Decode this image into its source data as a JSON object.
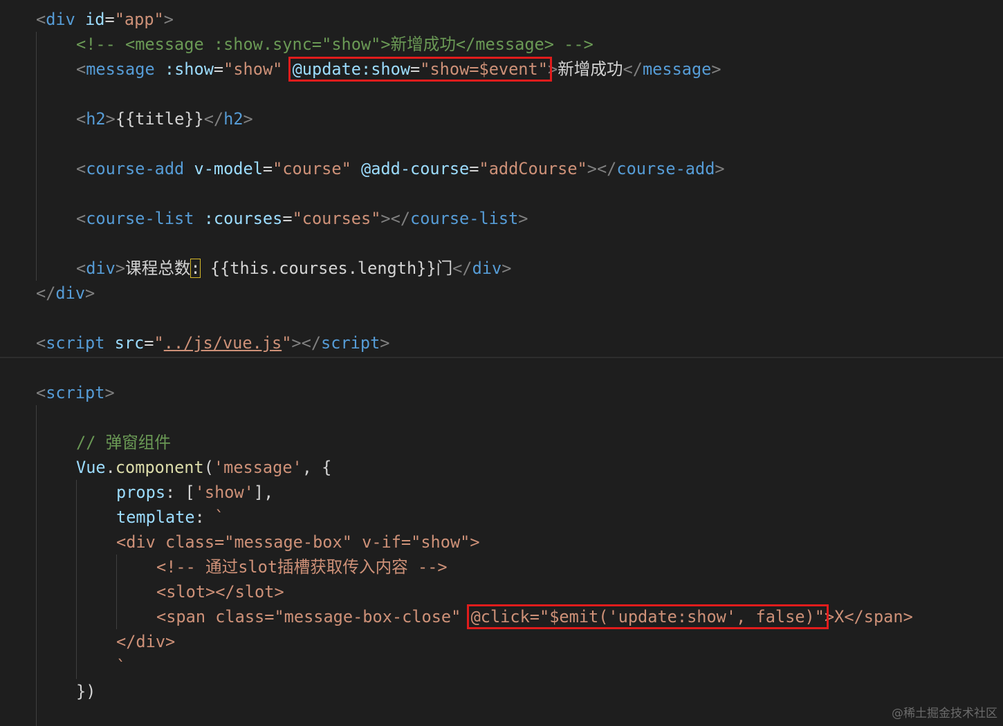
{
  "editor": {
    "colors": {
      "background": "#1e1e1e",
      "tag": "#569cd6",
      "attribute": "#9cdcfe",
      "string": "#ce9178",
      "comment": "#6a9955",
      "function": "#dcdcaa",
      "highlight_box": "#e11c1c"
    },
    "lines": [
      {
        "tokens": [
          {
            "t": "<",
            "c": "ang"
          },
          {
            "t": "div",
            "c": "tag"
          },
          {
            "t": " ",
            "c": "text"
          },
          {
            "t": "id",
            "c": "attr"
          },
          {
            "t": "=",
            "c": "eq"
          },
          {
            "t": "\"app\"",
            "c": "str"
          },
          {
            "t": ">",
            "c": "ang"
          }
        ]
      },
      {
        "tokens": [
          {
            "t": "<!-- <message :show.sync=\"show\">新增成功</message> -->",
            "c": "com"
          }
        ]
      },
      {
        "tokens": [
          {
            "t": "<",
            "c": "ang"
          },
          {
            "t": "message",
            "c": "tag"
          },
          {
            "t": " ",
            "c": "text"
          },
          {
            "t": ":show",
            "c": "attr"
          },
          {
            "t": "=",
            "c": "eq"
          },
          {
            "t": "\"show\"",
            "c": "str"
          },
          {
            "t": " ",
            "c": "text"
          },
          {
            "t": "@update:show",
            "c": "attr"
          },
          {
            "t": "=",
            "c": "eq"
          },
          {
            "t": "\"show=$event\"",
            "c": "str"
          },
          {
            "t": ">",
            "c": "ang"
          },
          {
            "t": "新增成功",
            "c": "text"
          },
          {
            "t": "</",
            "c": "ang"
          },
          {
            "t": "message",
            "c": "tag"
          },
          {
            "t": ">",
            "c": "ang"
          }
        ]
      },
      {
        "tokens": []
      },
      {
        "tokens": [
          {
            "t": "<",
            "c": "ang"
          },
          {
            "t": "h2",
            "c": "tag"
          },
          {
            "t": ">",
            "c": "ang"
          },
          {
            "t": "{{title}}",
            "c": "text"
          },
          {
            "t": "</",
            "c": "ang"
          },
          {
            "t": "h2",
            "c": "tag"
          },
          {
            "t": ">",
            "c": "ang"
          }
        ]
      },
      {
        "tokens": []
      },
      {
        "tokens": [
          {
            "t": "<",
            "c": "ang"
          },
          {
            "t": "course-add",
            "c": "tag"
          },
          {
            "t": " ",
            "c": "text"
          },
          {
            "t": "v-model",
            "c": "attr"
          },
          {
            "t": "=",
            "c": "eq"
          },
          {
            "t": "\"course\"",
            "c": "str"
          },
          {
            "t": " ",
            "c": "text"
          },
          {
            "t": "@add-course",
            "c": "attr"
          },
          {
            "t": "=",
            "c": "eq"
          },
          {
            "t": "\"addCourse\"",
            "c": "str"
          },
          {
            "t": "></",
            "c": "ang"
          },
          {
            "t": "course-add",
            "c": "tag"
          },
          {
            "t": ">",
            "c": "ang"
          }
        ]
      },
      {
        "tokens": []
      },
      {
        "tokens": [
          {
            "t": "<",
            "c": "ang"
          },
          {
            "t": "course-list",
            "c": "tag"
          },
          {
            "t": " ",
            "c": "text"
          },
          {
            "t": ":courses",
            "c": "attr"
          },
          {
            "t": "=",
            "c": "eq"
          },
          {
            "t": "\"courses\"",
            "c": "str"
          },
          {
            "t": "></",
            "c": "ang"
          },
          {
            "t": "course-list",
            "c": "tag"
          },
          {
            "t": ">",
            "c": "ang"
          }
        ]
      },
      {
        "tokens": []
      },
      {
        "tokens": [
          {
            "t": "<",
            "c": "ang"
          },
          {
            "t": "div",
            "c": "tag"
          },
          {
            "t": ">",
            "c": "ang"
          },
          {
            "t": "课程总数",
            "c": "text"
          },
          {
            "t": ":",
            "c": "text"
          },
          {
            "t": " {{this.courses.length}}门",
            "c": "text"
          },
          {
            "t": "</",
            "c": "ang"
          },
          {
            "t": "div",
            "c": "tag"
          },
          {
            "t": ">",
            "c": "ang"
          }
        ]
      },
      {
        "tokens": [
          {
            "t": "</",
            "c": "ang"
          },
          {
            "t": "div",
            "c": "tag"
          },
          {
            "t": ">",
            "c": "ang"
          }
        ]
      },
      {
        "tokens": []
      },
      {
        "tokens": [
          {
            "t": "<",
            "c": "ang"
          },
          {
            "t": "script",
            "c": "tag"
          },
          {
            "t": " ",
            "c": "text"
          },
          {
            "t": "src",
            "c": "attr"
          },
          {
            "t": "=",
            "c": "eq"
          },
          {
            "t": "\"",
            "c": "str"
          },
          {
            "t": "../js/vue.js",
            "c": "link"
          },
          {
            "t": "\"",
            "c": "str"
          },
          {
            "t": "></",
            "c": "ang"
          },
          {
            "t": "script",
            "c": "tag"
          },
          {
            "t": ">",
            "c": "ang"
          }
        ]
      },
      {
        "tokens": []
      },
      {
        "tokens": [
          {
            "t": "<",
            "c": "ang"
          },
          {
            "t": "script",
            "c": "tag"
          },
          {
            "t": ">",
            "c": "ang"
          }
        ]
      },
      {
        "tokens": []
      },
      {
        "tokens": [
          {
            "t": "// 弹窗组件",
            "c": "com"
          }
        ]
      },
      {
        "tokens": [
          {
            "t": "Vue",
            "c": "prop"
          },
          {
            "t": ".",
            "c": "punc"
          },
          {
            "t": "component",
            "c": "func"
          },
          {
            "t": "(",
            "c": "punc"
          },
          {
            "t": "'message'",
            "c": "str"
          },
          {
            "t": ", {",
            "c": "punc"
          }
        ]
      },
      {
        "tokens": [
          {
            "t": "props",
            "c": "prop"
          },
          {
            "t": ": [",
            "c": "punc"
          },
          {
            "t": "'show'",
            "c": "str"
          },
          {
            "t": "],",
            "c": "punc"
          }
        ]
      },
      {
        "tokens": [
          {
            "t": "template",
            "c": "prop"
          },
          {
            "t": ": ",
            "c": "punc"
          },
          {
            "t": "`",
            "c": "tpl"
          }
        ]
      },
      {
        "tokens": [
          {
            "t": "<div class=\"message-box\" v-if=\"show\">",
            "c": "tpl"
          }
        ]
      },
      {
        "tokens": [
          {
            "t": "<!-- 通过slot插槽获取传入内容 -->",
            "c": "tpl"
          }
        ]
      },
      {
        "tokens": [
          {
            "t": "<slot></slot>",
            "c": "tpl"
          }
        ]
      },
      {
        "tokens": [
          {
            "t": "<span class=\"message-box-close\" ",
            "c": "tpl"
          },
          {
            "t": "@click=\"$emit('update:show', false)\"",
            "c": "tpl"
          },
          {
            "t": ">X</span>",
            "c": "tpl"
          }
        ]
      },
      {
        "tokens": [
          {
            "t": "</div>",
            "c": "tpl"
          }
        ]
      },
      {
        "tokens": [
          {
            "t": "`",
            "c": "tpl"
          }
        ]
      },
      {
        "tokens": [
          {
            "t": "})",
            "c": "punc"
          }
        ]
      }
    ]
  },
  "watermark": "@稀土掘金技术社区"
}
